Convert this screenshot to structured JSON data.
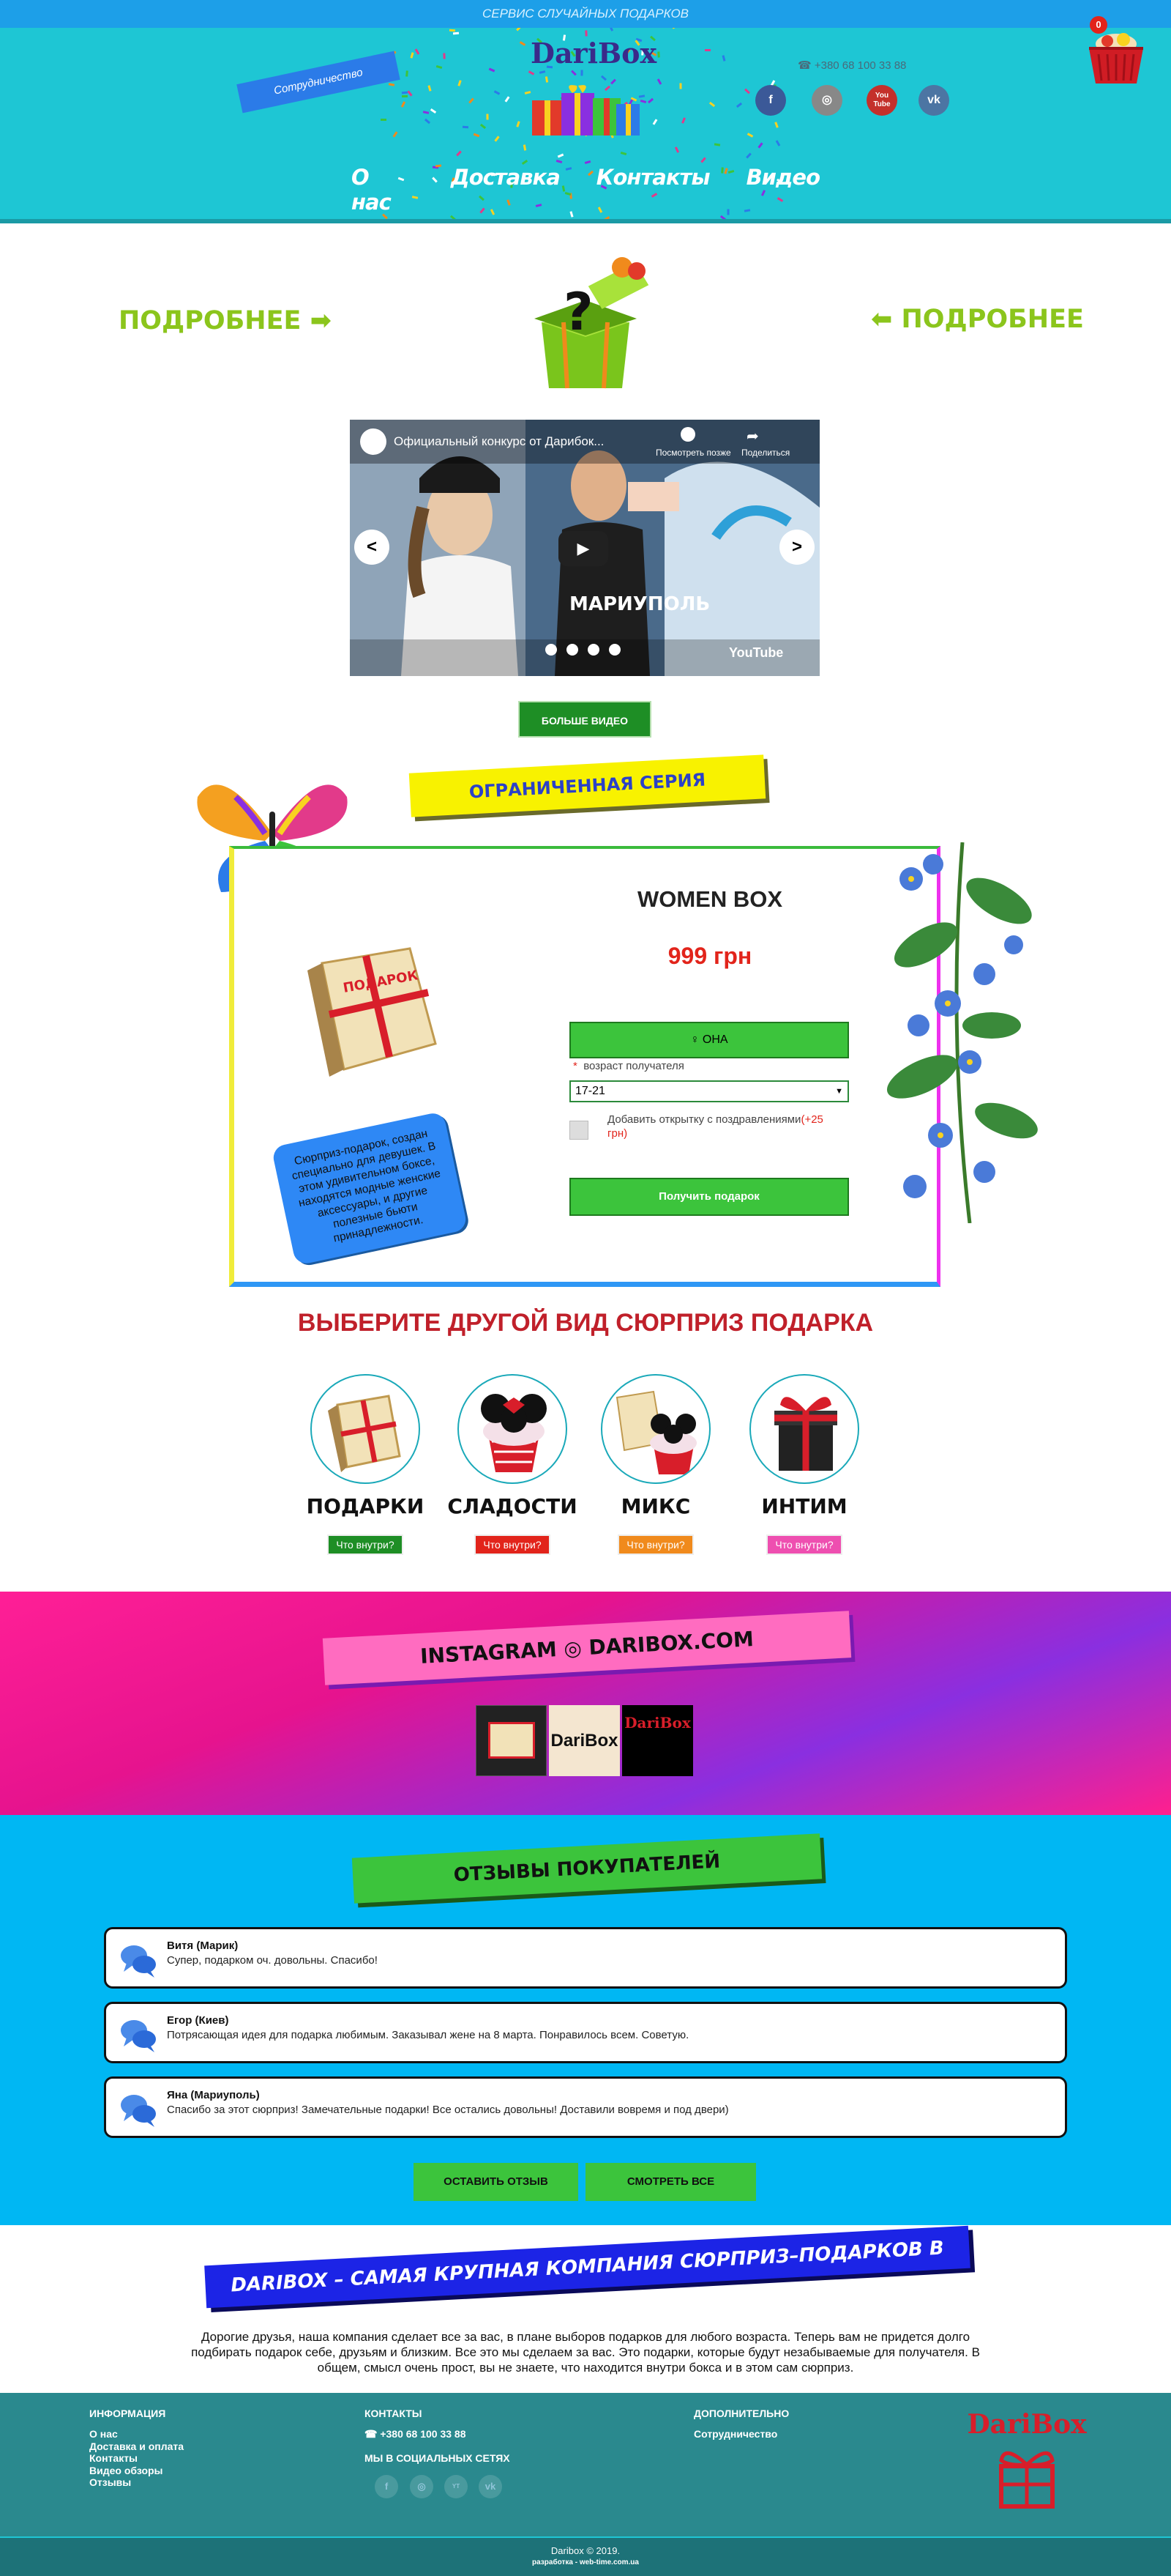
{
  "header": {
    "top_service": "СЕРВИС СЛУЧАЙНЫХ ПОДАРКОВ",
    "cooperation_label": "Сотрудничество",
    "logo_text": "DariBox",
    "phone": "☎ +380 68 100 33 88",
    "cart_count": "0",
    "social": [
      {
        "icon": "facebook-icon",
        "glyph": "f",
        "color": "#3b5998"
      },
      {
        "icon": "instagram-icon",
        "glyph": "◎",
        "color": "#888888"
      },
      {
        "icon": "youtube-icon",
        "glyph": "You Tube",
        "color": "#c4302b"
      },
      {
        "icon": "vk-icon",
        "glyph": "vk",
        "color": "#4c75a3"
      }
    ],
    "nav": [
      "О нас",
      "Доставка",
      "Контакты",
      "Видео"
    ]
  },
  "promo": {
    "more_left": "ПОДРОБНЕЕ ➡",
    "more_right": "⬅ ПОДРОБНЕЕ"
  },
  "video": {
    "title": "Официальный конкурс от Дарибок...",
    "watch_later": "Посмотреть позже",
    "share": "Поделиться",
    "prev": "<",
    "next": ">",
    "youtube_label": "YouTube",
    "more_button": "БОЛЬШЕ ВИДЕО"
  },
  "limited": {
    "banner": "ОГРАНИЧЕННАЯ СЕРИЯ",
    "product_name": "WOMEN BOX",
    "price": "999 грн",
    "gender_button": "♀ ОНА",
    "age_label": "возраст получателя",
    "age_value": "17-21",
    "postcard_label": "Добавить открытку с поздравлениями",
    "postcard_price": "(+25 грн)",
    "get_button": "Получить подарок",
    "description": "Сюрприз-подарок, создан специально для девушек. В этом удивительном боксе, находятся модные женские аксессуары, и другие полезные бьюти принадлежности."
  },
  "choose": {
    "title": "ВЫБЕРИТЕ ДРУГОЙ ВИД СЮРПРИЗ ПОДАРКА",
    "categories": [
      {
        "name": "ПОДАРКИ",
        "button": "Что внутри?",
        "color": "#1e8e25"
      },
      {
        "name": "СЛАДОСТИ",
        "button": "Что внутри?",
        "color": "#e2241b"
      },
      {
        "name": "МИКС",
        "button": "Что внутри?",
        "color": "#f08a1c"
      },
      {
        "name": "ИНТИМ",
        "button": "Что внутри?",
        "color": "#ee4fb0"
      }
    ]
  },
  "instagram": {
    "banner": "INSTAGRAM ◎ DARIBOX.COM"
  },
  "reviews": {
    "banner": "ОТЗЫВЫ ПОКУПАТЕЛЕЙ",
    "items": [
      {
        "author": "Витя (Марик)",
        "text": "Супер, подарком оч. довольны. Спасибо!"
      },
      {
        "author": "Егор (Киев)",
        "text": "Потрясающая идея для подарка любимым. Заказывал жене на 8 марта. Понравилось всем. Советую."
      },
      {
        "author": "Яна (Мариуполь)",
        "text": "Спасибо за этот сюрприз! Замечательные подарки! Все остались довольны! Доставили вовремя и под двери)"
      }
    ],
    "leave_button": "ОСТАВИТЬ ОТЗЫВ",
    "view_button": "СМОТРЕТЬ ВСЕ"
  },
  "about": {
    "banner": "DARIBOX – САМАЯ КРУПНАЯ КОМПАНИЯ СЮРПРИЗ–ПОДАРКОВ В УКРАИНЕ",
    "text": "Дорогие друзья, наша компания сделает все за вас, в плане выборов подарков для любого возраста. Теперь вам не придется долго подбирать подарок себе, друзьям и близким. Все это мы сделаем за вас. Это подарки, которые будут незабываемые для получателя. В общем, смысл очень прост, вы не знаете, что находится внутри бокса и в этом сам сюрприз."
  },
  "footer": {
    "info_head": "ИНФОРМАЦИЯ",
    "info_links": [
      "О нас",
      "Доставка и оплата",
      "Контакты",
      "Видео обзоры",
      "Отзывы"
    ],
    "contacts_head": "КОНТАКТЫ",
    "phone": "☎ +380 68 100 33 88",
    "social_head": "МЫ В СОЦИАЛЬНЫХ СЕТЯХ",
    "extra_head": "ДОПОЛНИТЕЛЬНО",
    "extra_link": "Сотрудничество",
    "logo_text": "DariBox",
    "copyright": "Daribox © 2019.",
    "dev": "разработка - web-time.com.ua"
  },
  "colors": {
    "header_bg": "#1ec6d4",
    "accent_green": "#3cc43c",
    "price_red": "#e2241b",
    "reviews_bg": "#00b7f3",
    "footer_bg": "#2a898e"
  }
}
